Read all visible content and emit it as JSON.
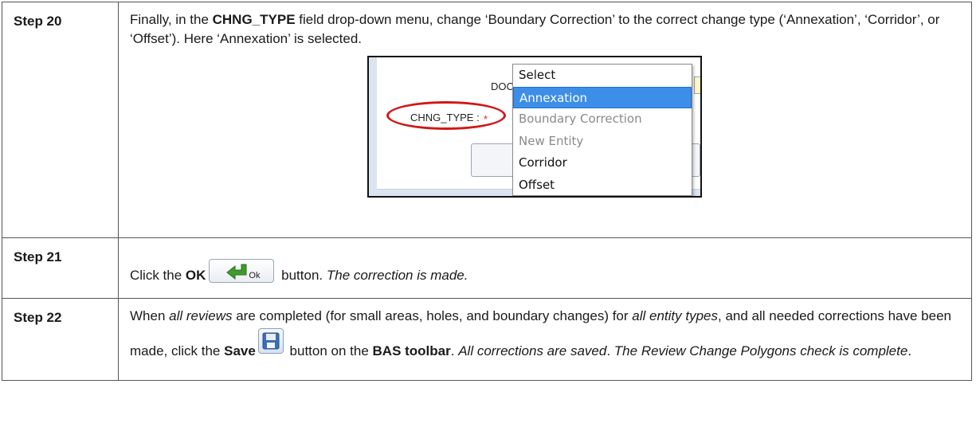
{
  "steps": [
    {
      "label": "Step 20",
      "text": {
        "p1": "Finally, in the ",
        "b1": "CHNG_TYPE",
        "p2": " field drop-down menu, change ‘Boundary Correction’ to the correct change type (‘Annexation’, ‘Corridor’, or ‘Offset’). Here ‘Annexation’ is selected."
      },
      "screenshot": {
        "docu_label": "DOCU :",
        "chng_type_label": "CHNG_TYPE :",
        "required_mark": "*",
        "options": [
          "Select",
          "Annexation",
          "Boundary Correction",
          "New Entity",
          "Corridor",
          "Offset"
        ],
        "selected": "Annexation",
        "disabled": [
          "Boundary Correction",
          "New Entity"
        ]
      }
    },
    {
      "label": "Step 21",
      "text": {
        "p1": "Click the ",
        "b1": "OK",
        "ok_icon_label": "Ok",
        "p2": " button. ",
        "i1": "The correction is made."
      }
    },
    {
      "label": "Step 22",
      "text": {
        "p1": "When ",
        "i1": "all reviews",
        "p2": " are completed (for small areas, holes, and boundary changes) for ",
        "i2": "all entity types",
        "p3": ", and all needed corrections have been made, click the ",
        "b1": "Save",
        "p4": " button on the ",
        "b2": "BAS toolbar",
        "p5": ". ",
        "i3": "All corrections are saved",
        "p6": ". ",
        "i4": "The Review Change Polygons check is complete",
        "p7": "."
      }
    }
  ],
  "colors": {
    "selected_option": "#3d8ee8",
    "highlight_ellipse": "#d01818",
    "required_star": "#e22222"
  },
  "icons": [
    "green-arrow-ok-icon",
    "save-floppy-icon"
  ]
}
